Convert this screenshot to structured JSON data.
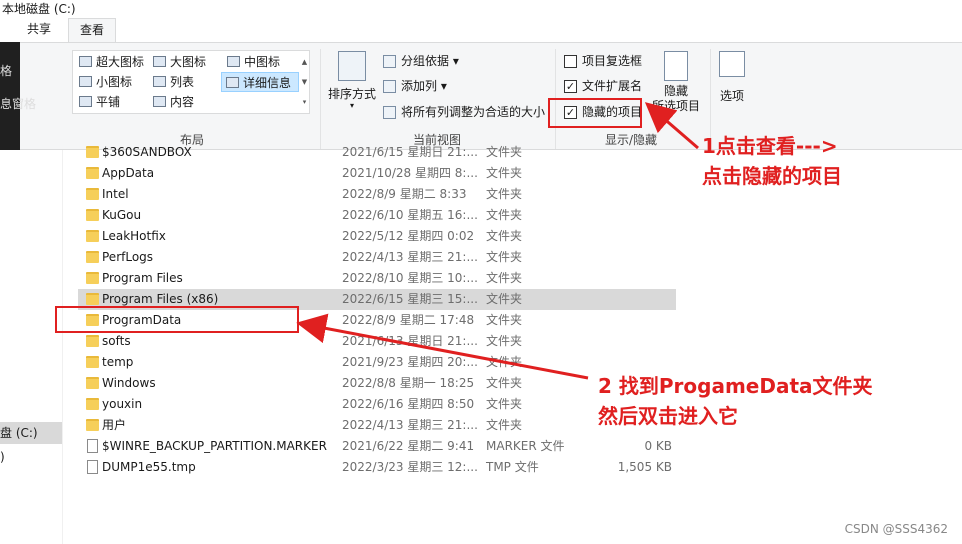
{
  "window": {
    "title": "本地磁盘 (C:)"
  },
  "tabs": [
    {
      "label": "共享"
    },
    {
      "label": "查看"
    }
  ],
  "nav_pane_partial": {
    "item_a": "格",
    "item_b": "息窗格",
    "drive_partial": "盘 (C:)",
    "paren": ")"
  },
  "layout_group": {
    "label": "布局",
    "items": [
      {
        "label": "超大图标"
      },
      {
        "label": "大图标"
      },
      {
        "label": "中图标"
      },
      {
        "label": "小图标"
      },
      {
        "label": "列表"
      },
      {
        "label": "详细信息"
      },
      {
        "label": "平铺"
      },
      {
        "label": "内容"
      }
    ],
    "selected": "详细信息"
  },
  "current_view_group": {
    "label": "当前视图",
    "sort_label": "排序方式",
    "group_by": "分组依据",
    "add_column": "添加列",
    "fit_columns": "将所有列调整为合适的大小"
  },
  "show_hide_group": {
    "label": "显示/隐藏",
    "item_checkbox": {
      "label": "项目复选框",
      "checked": false
    },
    "file_ext": {
      "label": "文件扩展名",
      "checked": true
    },
    "hidden_items": {
      "label": "隐藏的项目",
      "checked": true
    },
    "hide_selected_top": "隐藏",
    "hide_selected_bottom": "所选项目"
  },
  "options_button": "选项",
  "files": [
    {
      "name": "$360SANDBOX",
      "date": "2021/6/15 星期日 21:...",
      "type": "文件夹",
      "size": "",
      "kind": "folder"
    },
    {
      "name": "AppData",
      "date": "2021/10/28 星期四 8:...",
      "type": "文件夹",
      "size": "",
      "kind": "folder"
    },
    {
      "name": "Intel",
      "date": "2022/8/9 星期二 8:33",
      "type": "文件夹",
      "size": "",
      "kind": "folder"
    },
    {
      "name": "KuGou",
      "date": "2022/6/10 星期五 16:...",
      "type": "文件夹",
      "size": "",
      "kind": "folder"
    },
    {
      "name": "LeakHotfix",
      "date": "2022/5/12 星期四 0:02",
      "type": "文件夹",
      "size": "",
      "kind": "folder"
    },
    {
      "name": "PerfLogs",
      "date": "2022/4/13 星期三 21:...",
      "type": "文件夹",
      "size": "",
      "kind": "folder"
    },
    {
      "name": "Program Files",
      "date": "2022/8/10 星期三 10:...",
      "type": "文件夹",
      "size": "",
      "kind": "folder"
    },
    {
      "name": "Program Files (x86)",
      "date": "2022/6/15 星期三 15:...",
      "type": "文件夹",
      "size": "",
      "kind": "folder",
      "highlighted": true
    },
    {
      "name": "ProgramData",
      "date": "2022/8/9 星期二 17:48",
      "type": "文件夹",
      "size": "",
      "kind": "folder"
    },
    {
      "name": "softs",
      "date": "2021/6/13 星期日 21:...",
      "type": "文件夹",
      "size": "",
      "kind": "folder"
    },
    {
      "name": "temp",
      "date": "2021/9/23 星期四 20:...",
      "type": "文件夹",
      "size": "",
      "kind": "folder"
    },
    {
      "name": "Windows",
      "date": "2022/8/8 星期一 18:25",
      "type": "文件夹",
      "size": "",
      "kind": "folder"
    },
    {
      "name": "youxin",
      "date": "2022/6/16 星期四 8:50",
      "type": "文件夹",
      "size": "",
      "kind": "folder"
    },
    {
      "name": "用户",
      "date": "2022/4/13 星期三 21:...",
      "type": "文件夹",
      "size": "",
      "kind": "folder"
    },
    {
      "name": "$WINRE_BACKUP_PARTITION.MARKER",
      "date": "2021/6/22 星期二 9:41",
      "type": "MARKER 文件",
      "size": "0 KB",
      "kind": "file"
    },
    {
      "name": "DUMP1e55.tmp",
      "date": "2022/3/23 星期三 12:...",
      "type": "TMP 文件",
      "size": "1,505 KB",
      "kind": "file"
    }
  ],
  "annotations": {
    "step1_line1": "1点击查看--->",
    "step1_line2": "点击隐藏的项目",
    "step2_line1": "2 找到ProgameData文件夹",
    "step2_line2": "然后双击进入它",
    "color": "#e02020"
  },
  "watermark": "CSDN @SSS4362"
}
